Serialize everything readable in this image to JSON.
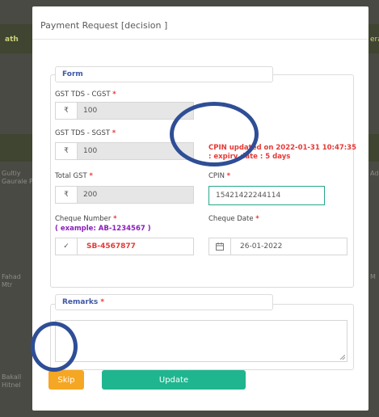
{
  "background": {
    "snippets": [
      "ath",
      "erat",
      "Gultiy",
      "Gaurale Pi",
      "Ad",
      "Fahad",
      "Bakall"
    ],
    "small_lines": [
      "Mtr",
      "Hitnel",
      "M"
    ]
  },
  "modal": {
    "title": "Payment Request [decision ]",
    "form": {
      "legend": "Form",
      "gst_cgst": {
        "label": "GST TDS - CGST",
        "required": "*",
        "currency": "₹",
        "value": "100"
      },
      "gst_sgst": {
        "label": "GST TDS - SGST",
        "required": "*",
        "currency": "₹",
        "value": "100"
      },
      "cpin_message": {
        "line1": "CPIN updated on 2022-01-31 10:47:35",
        "line2": ": expiry date : 5 days"
      },
      "total_gst": {
        "label": "Total GST",
        "required": "*",
        "currency": "₹",
        "value": "200"
      },
      "cpin": {
        "label": "CPIN",
        "required": "*",
        "value": "15421422244114"
      },
      "cheque_number": {
        "label": "Cheque Number",
        "required": "*",
        "hint": "( example: AB-1234567 )",
        "value": "SB-4567877"
      },
      "cheque_date": {
        "label": "Cheque Date",
        "required": "*",
        "value": "26-01-2022"
      }
    },
    "remarks": {
      "legend": "Remarks",
      "required": "*",
      "value": ""
    },
    "buttons": {
      "skip": "Skip",
      "update": "Update"
    },
    "colors": {
      "accent_blue": "#3d57a6",
      "required_red": "#e53935",
      "update_green": "#1fb58f",
      "skip_orange": "#f5a623",
      "annotation_circle": "#2e4e96"
    }
  }
}
